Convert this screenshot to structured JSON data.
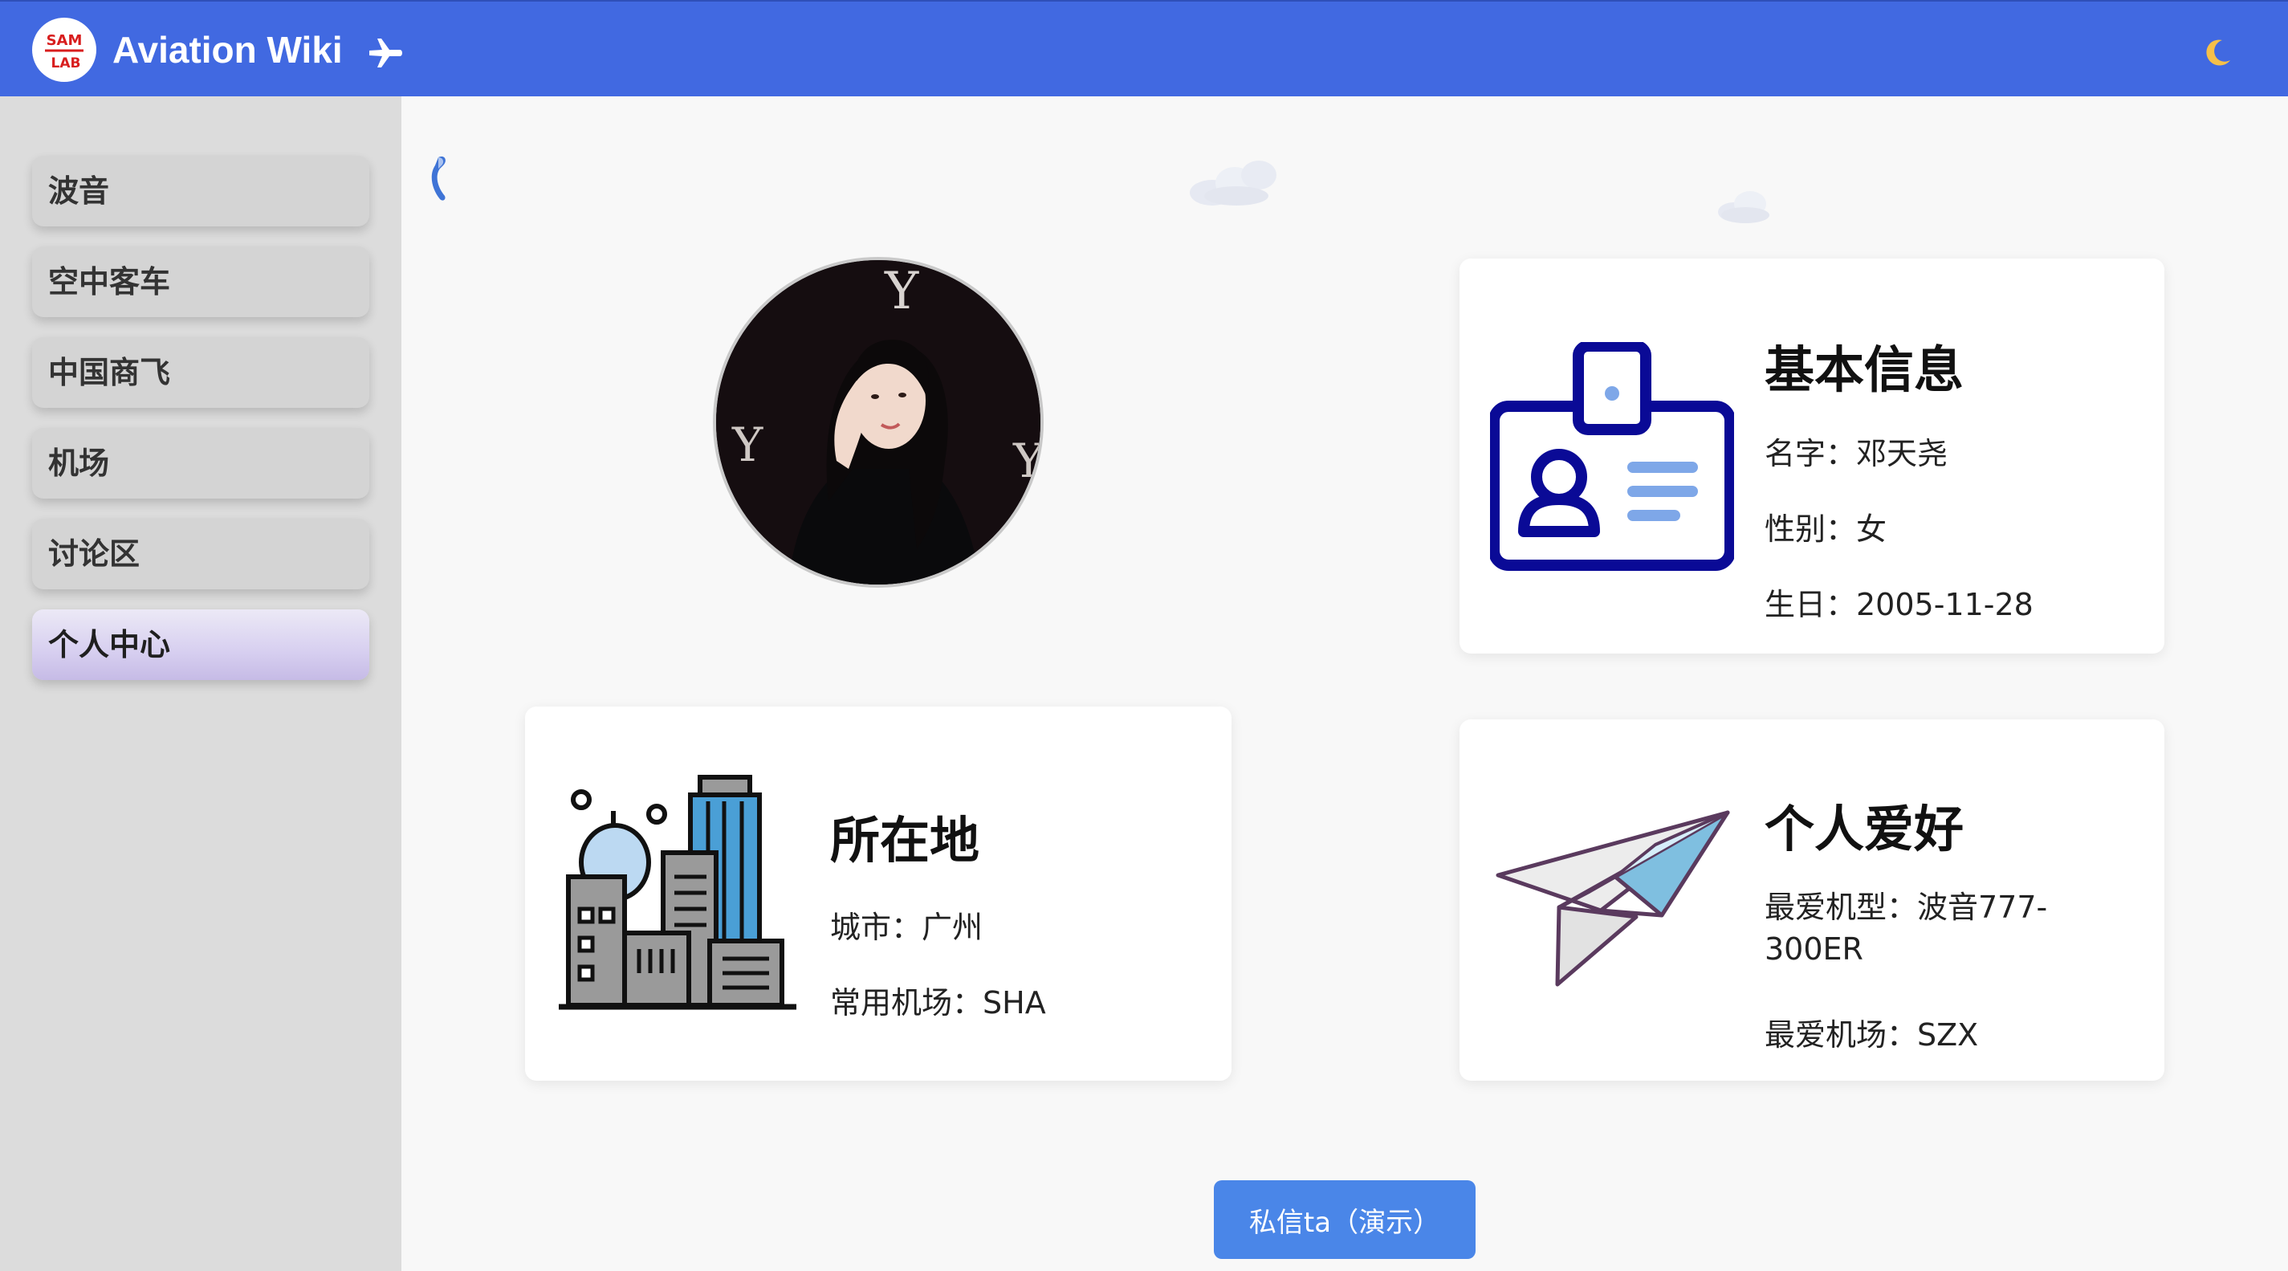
{
  "header": {
    "app_title": "Aviation Wiki",
    "logo_text_top": "SAM",
    "logo_text_bottom": "LAB",
    "plane_icon": "airplane-icon",
    "theme_icon": "moon-icon"
  },
  "sidebar": {
    "items": [
      {
        "label": "波音"
      },
      {
        "label": "空中客车"
      },
      {
        "label": "中国商飞"
      },
      {
        "label": "机场"
      },
      {
        "label": "讨论区"
      },
      {
        "label": "个人中心",
        "active": true
      }
    ]
  },
  "basic_info": {
    "title": "基本信息",
    "name": "名字：邓天尧",
    "gender": "性别：女",
    "birthday": "生日：2005-11-28",
    "icon": "id-card-icon"
  },
  "location": {
    "title": "所在地",
    "city": "城市：广州",
    "airport": "常用机场：SHA",
    "icon": "city-buildings-icon"
  },
  "hobbies": {
    "title": "个人爱好",
    "fav_aircraft": "最爱机型：波音777-300ER",
    "fav_airport": "最爱机场：SZX",
    "icon": "paper-plane-icon"
  },
  "actions": {
    "message_button": "私信ta（演示）"
  },
  "colors": {
    "header": "#4169e1",
    "sidebar": "#dcdcdc",
    "button": "#4a86e8",
    "id_card_stroke": "#0a0a96",
    "id_card_lines": "#7ea7e8"
  }
}
